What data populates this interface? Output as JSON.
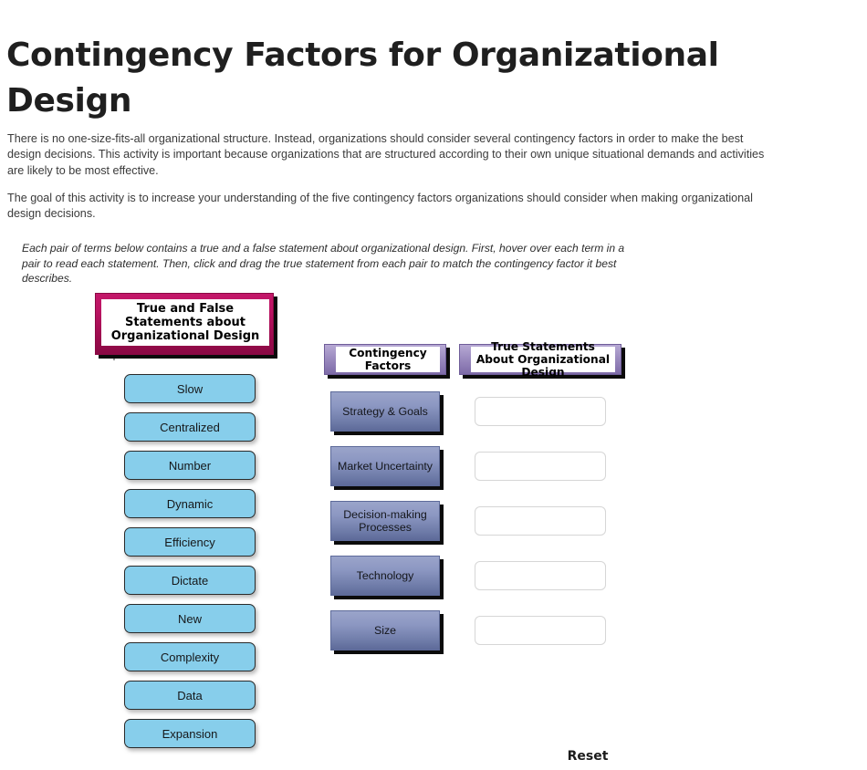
{
  "page": {
    "title": "Contingency Factors for Organizational Design",
    "intro_paragraph_1": "There is no one-size-fits-all organizational structure. Instead, organizations should consider several contingency factors in order to make the best design decisions. This activity is important because organizations that are structured according to their own unique situational demands and activities are likely to be most effective.",
    "intro_paragraph_2": "The goal of this activity is to increase your understanding of the five contingency factors organizations should consider when making organizational design decisions.",
    "instructions": "Each pair of terms below contains a true and a false statement about organizational design. First, hover over each term in a pair to read each statement. Then, click and drag the true statement from each pair to match the contingency factor it best describes."
  },
  "source_bank": {
    "header": "True and False Statements about Organizational Design",
    "terms": [
      {
        "label": "Slow"
      },
      {
        "label": "Centralized"
      },
      {
        "label": "Number"
      },
      {
        "label": "Dynamic"
      },
      {
        "label": "Efficiency"
      },
      {
        "label": "Dictate"
      },
      {
        "label": "New"
      },
      {
        "label": "Complexity"
      },
      {
        "label": "Data"
      },
      {
        "label": "Expansion"
      }
    ]
  },
  "match_area": {
    "factors_header": "Contingency Factors",
    "statements_header": "True Statements About Organizational Design",
    "rows": [
      {
        "factor": "Strategy & Goals",
        "answer": ""
      },
      {
        "factor": "Market Uncertainty",
        "answer": ""
      },
      {
        "factor": "Decision-making Processes",
        "answer": ""
      },
      {
        "factor": "Technology",
        "answer": ""
      },
      {
        "factor": "Size",
        "answer": ""
      }
    ]
  },
  "controls": {
    "reset_label": "Reset"
  },
  "colors": {
    "bank_header_top": "#c31769",
    "bank_header_bottom": "#8a0944",
    "term_fill": "#87ceeb",
    "col_header_top": "#b7a9d4",
    "col_header_bottom": "#7e6ba8",
    "factor_top": "#9aa4ca",
    "factor_bottom": "#5d6a99",
    "drop_zone_border": "#d6d6d6"
  }
}
